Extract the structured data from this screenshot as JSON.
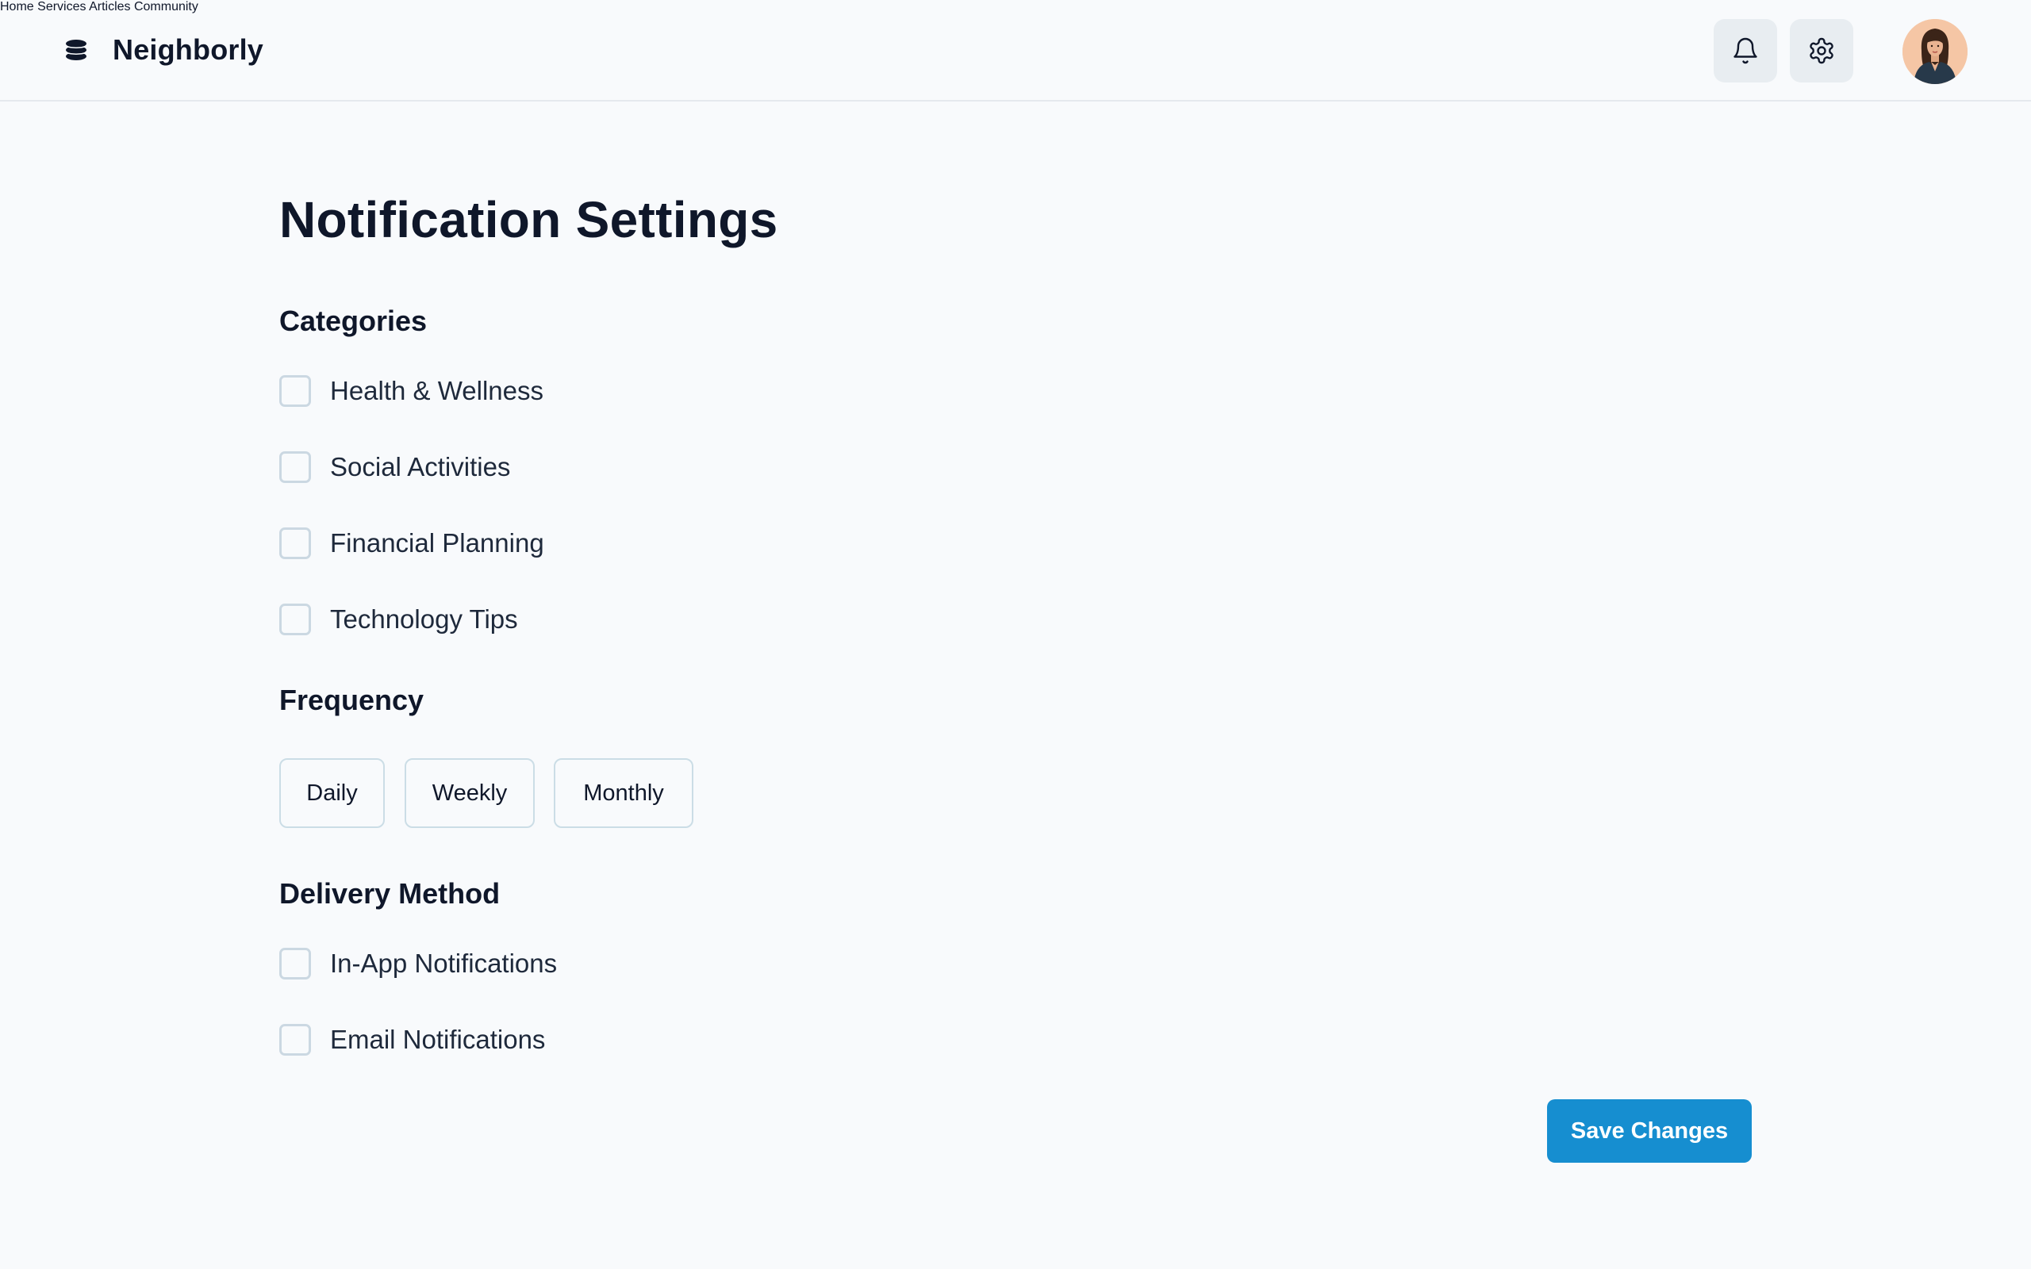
{
  "brand": {
    "name": "Neighborly",
    "logo_icon": "stacked-layers-icon"
  },
  "nav": {
    "items": [
      "Home",
      "Services",
      "Articles",
      "Community"
    ]
  },
  "header_actions": {
    "notifications_icon": "bell-icon",
    "settings_icon": "gear-icon",
    "avatar": "user-avatar"
  },
  "page": {
    "title": "Notification Settings"
  },
  "categories": {
    "heading": "Categories",
    "options": [
      "Health & Wellness",
      "Social Activities",
      "Financial Planning",
      "Technology Tips"
    ]
  },
  "frequency": {
    "heading": "Frequency",
    "options": [
      "Daily",
      "Weekly",
      "Monthly"
    ]
  },
  "delivery": {
    "heading": "Delivery Method",
    "options": [
      "In-App Notifications",
      "Email Notifications"
    ]
  },
  "actions": {
    "save_label": "Save Changes"
  },
  "colors": {
    "accent": "#168ed0",
    "background": "#f8fafc",
    "text": "#0f172a",
    "icon_button_bg": "#e8edf1",
    "checkbox_border": "#cbd8e2"
  }
}
